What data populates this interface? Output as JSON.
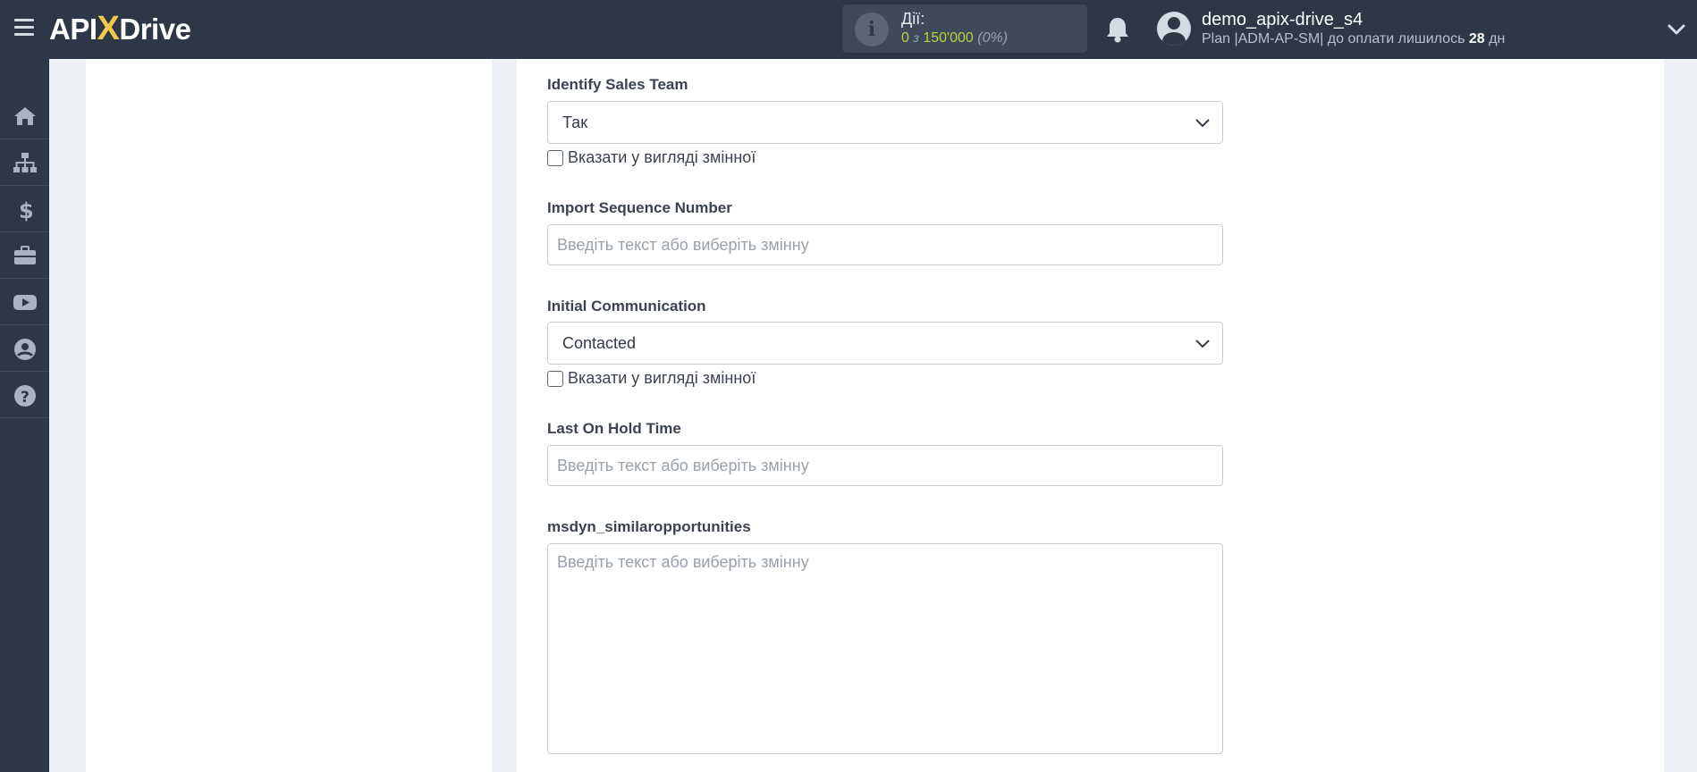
{
  "header": {
    "logo_prefix": "API",
    "logo_x": "X",
    "logo_suffix": "Drive",
    "actions_title": "Дії:",
    "actions_used": "0",
    "actions_of": "з",
    "actions_limit": "150'000",
    "actions_percent": "(0%)",
    "username": "demo_apix-drive_s4",
    "plan_text": "Plan |ADM-AP-SM| до оплати лишилось",
    "plan_days": "28",
    "plan_days_unit": "дн"
  },
  "sidebar": {
    "items": [
      {
        "icon": "home-icon"
      },
      {
        "icon": "sitemap-icon"
      },
      {
        "icon": "dollar-icon"
      },
      {
        "icon": "briefcase-icon"
      },
      {
        "icon": "youtube-icon"
      },
      {
        "icon": "user-circle-icon"
      },
      {
        "icon": "help-icon"
      }
    ]
  },
  "form": {
    "identify_sales_team": {
      "label": "Identify Sales Team",
      "value": "Так",
      "checkbox_label": "Вказати у вигляді змінної"
    },
    "import_sequence_number": {
      "label": "Import Sequence Number",
      "placeholder": "Введіть текст або виберіть змінну"
    },
    "initial_communication": {
      "label": "Initial Communication",
      "value": "Contacted",
      "checkbox_label": "Вказати у вигляді змінної"
    },
    "last_on_hold_time": {
      "label": "Last On Hold Time",
      "placeholder": "Введіть текст або виберіть змінну"
    },
    "similar_opportunities": {
      "label": "msdyn_similaropportunities",
      "placeholder": "Введіть текст або виберіть змінну"
    }
  },
  "colors": {
    "topbar": "#2d3748",
    "accent": "#c0cf3c",
    "logo_x": "#f2c94c",
    "background": "#edf0f5"
  }
}
